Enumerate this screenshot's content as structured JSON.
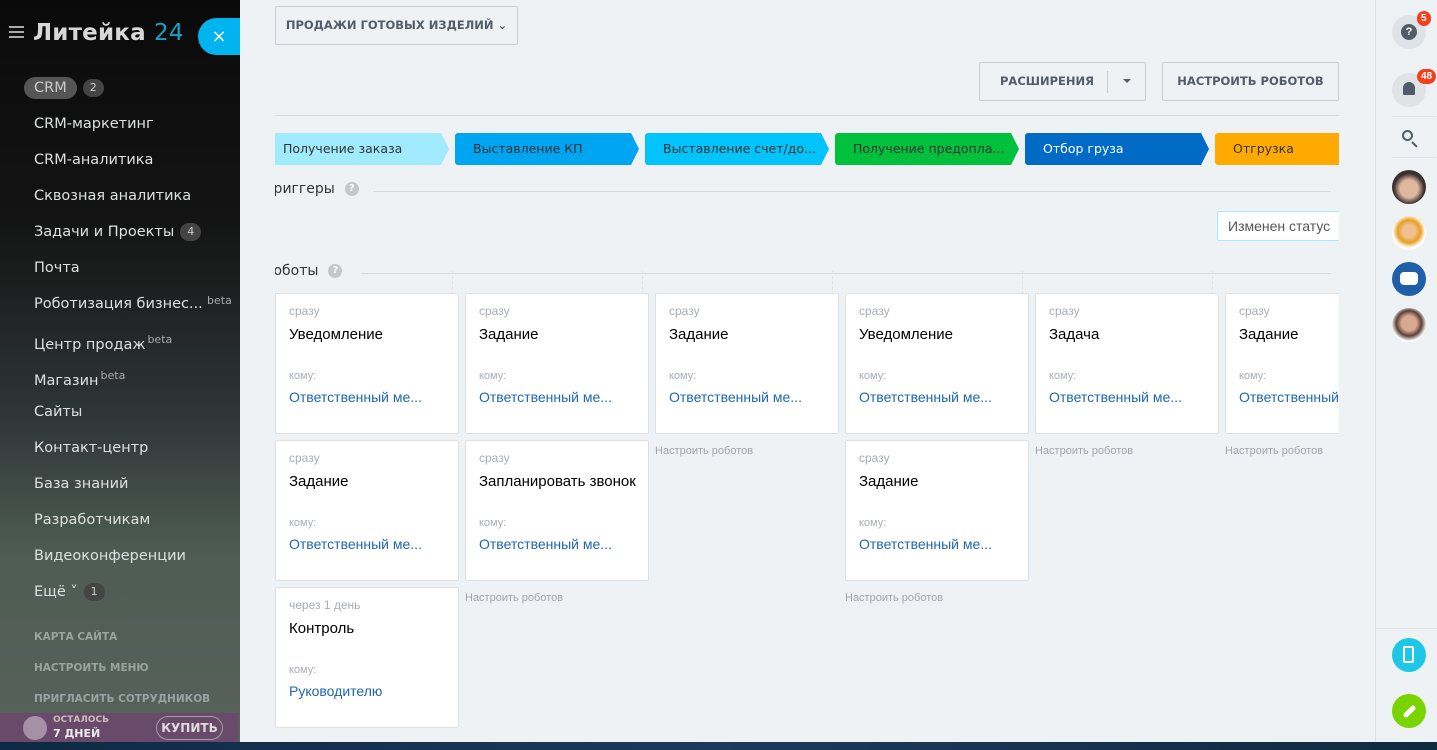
{
  "sidebar": {
    "logo": "Литейка",
    "logo_num": "24",
    "close": "×",
    "items": [
      {
        "label": "CRM",
        "count": "2",
        "active": true
      },
      {
        "label": "CRM-маркетинг"
      },
      {
        "label": "CRM-аналитика"
      },
      {
        "label": "Сквозная аналитика"
      },
      {
        "label": "Задачи и Проекты",
        "count": "4"
      },
      {
        "label": "Почта"
      },
      {
        "label": "Роботизация бизнес...",
        "beta": "beta",
        "beta_far": true
      },
      {
        "label": "Центр продаж",
        "beta": "beta"
      },
      {
        "label": "Магазин",
        "beta": "beta"
      },
      {
        "label": "Сайты"
      },
      {
        "label": "Контакт-центр"
      },
      {
        "label": "База знаний"
      },
      {
        "label": "Разработчикам"
      },
      {
        "label": "Видеоконференции"
      },
      {
        "label": "Ещё ˅",
        "count": "1"
      }
    ],
    "links": [
      "КАРТА САЙТА",
      "НАСТРОИТЬ МЕНЮ",
      "ПРИГЛАСИТЬ СОТРУДНИКОВ"
    ],
    "trial": {
      "label": "ОСТАЛОСЬ",
      "days": "7 ДНЕЙ",
      "buy": "КУПИТЬ"
    }
  },
  "toolbar": {
    "category": "ПРОДАЖИ ГОТОВЫХ ИЗДЕЛИЙ",
    "extensions": "РАСШИРЕНИЯ",
    "configure_robots": "НАСТРОИТЬ РОБОТОВ"
  },
  "stages": [
    {
      "label": "Получение заказа",
      "color": "#a0ebfd",
      "text": "#333"
    },
    {
      "label": "Выставление КП",
      "color": "#00a5f2",
      "text": "#333"
    },
    {
      "label": "Выставление счет/до...",
      "color": "#00c4fb",
      "text": "#333"
    },
    {
      "label": "Получение предопла...",
      "color": "#00c03c",
      "text": "#333"
    },
    {
      "label": "Отбор груза",
      "color": "#006bc7",
      "text": "#fff"
    },
    {
      "label": "Отгрузка",
      "color": "#ffaa00",
      "text": "#333"
    }
  ],
  "triggers": {
    "title": "Триггеры",
    "item": "Изменен статус"
  },
  "robots": {
    "title": "Роботы",
    "add_label": "Настроить роботов",
    "columns": [
      [
        {
          "delay": "сразу",
          "title": "Уведомление",
          "to": "кому:",
          "user": "Ответственный ме..."
        },
        {
          "delay": "сразу",
          "title": "Задание",
          "to": "кому:",
          "user": "Ответственный ме..."
        },
        {
          "delay": "через 1 день",
          "title": "Контроль",
          "to": "кому:",
          "user": "Руководителю"
        }
      ],
      [
        {
          "delay": "сразу",
          "title": "Задание",
          "to": "кому:",
          "user": "Ответственный ме..."
        },
        {
          "delay": "сразу",
          "title": "Запланировать звонок",
          "to": "кому:",
          "user": "Ответственный ме..."
        }
      ],
      [
        {
          "delay": "сразу",
          "title": "Задание",
          "to": "кому:",
          "user": "Ответственный ме..."
        }
      ],
      [
        {
          "delay": "сразу",
          "title": "Уведомление",
          "to": "кому:",
          "user": "Ответственный ме..."
        },
        {
          "delay": "сразу",
          "title": "Задание",
          "to": "кому:",
          "user": "Ответственный ме..."
        }
      ],
      [
        {
          "delay": "сразу",
          "title": "Задача",
          "to": "кому:",
          "user": "Ответственный ме..."
        }
      ],
      [
        {
          "delay": "сразу",
          "title": "Задание",
          "to": "кому:",
          "user": "Ответственный ме..."
        }
      ]
    ]
  },
  "right": {
    "help_badge": "5",
    "notif_badge": "48"
  }
}
